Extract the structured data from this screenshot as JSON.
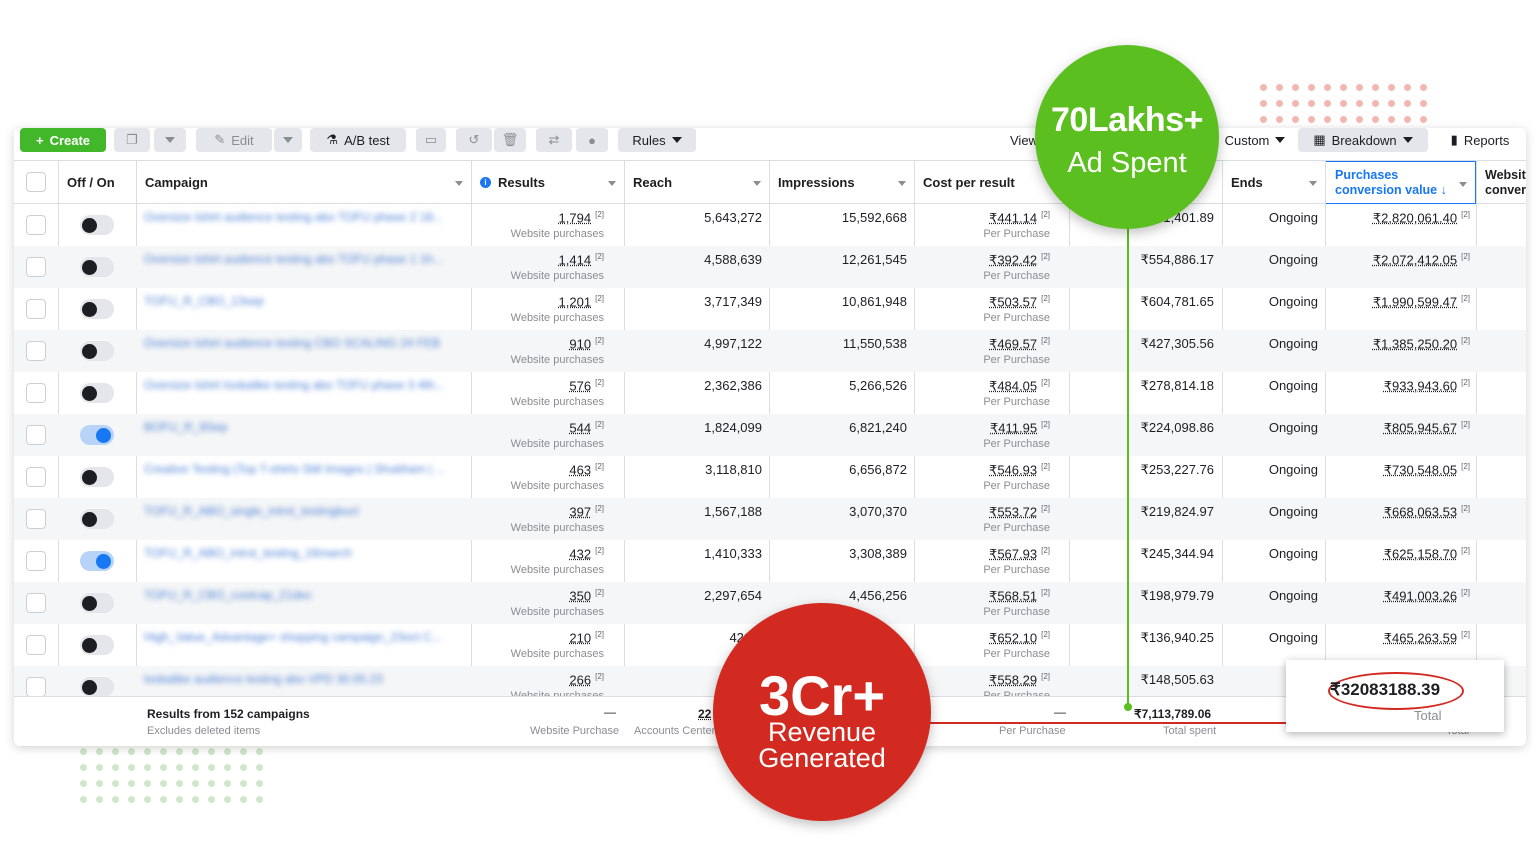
{
  "toolbar": {
    "create": "Create",
    "edit": "Edit",
    "ab_test": "A/B test",
    "rules": "Rules",
    "view": "View",
    "custom": "Custom",
    "breakdown": "Breakdown",
    "reports": "Reports"
  },
  "columns": {
    "off_on": "Off / On",
    "campaign": "Campaign",
    "results": "Results",
    "reach": "Reach",
    "impressions": "Impressions",
    "cost_per_result": "Cost per result",
    "ends": "Ends",
    "purchases_line1": "Purchases",
    "purchases_line2": "conversion value ↓",
    "website_line1": "Websit",
    "website_line2": "conver"
  },
  "rows": [
    {
      "on": false,
      "campaign": "Oversize tshirt audience testing abo TOFU phase 2 18...",
      "results": "1,794",
      "results_sub": "Website purchases",
      "reach": "5,643,272",
      "impressions": "15,592,668",
      "cpr": "₹441.14",
      "cpr_sub": "Per Purchase",
      "spent": "₹1,401.89",
      "ends": "Ongoing",
      "pcv": "₹2,820,061.40"
    },
    {
      "on": false,
      "campaign": "Oversize tshirt audience testing abo TOFU phase 1 1h...",
      "results": "1,414",
      "results_sub": "Website purchases",
      "reach": "4,588,639",
      "impressions": "12,261,545",
      "cpr": "₹392.42",
      "cpr_sub": "Per Purchase",
      "spent": "₹554,886.17",
      "ends": "Ongoing",
      "pcv": "₹2,072,412.05"
    },
    {
      "on": false,
      "campaign": "TOFU_R_CBO_13sep",
      "results": "1,201",
      "results_sub": "Website purchases",
      "reach": "3,717,349",
      "impressions": "10,861,948",
      "cpr": "₹503.57",
      "cpr_sub": "Per Purchase",
      "spent": "₹604,781.65",
      "ends": "Ongoing",
      "pcv": "₹1,990,599.47"
    },
    {
      "on": false,
      "campaign": "Oversize tshirt audience testing CBO SCALING 24 FEB",
      "results": "910",
      "results_sub": "Website purchases",
      "reach": "4,997,122",
      "impressions": "11,550,538",
      "cpr": "₹469.57",
      "cpr_sub": "Per Purchase",
      "spent": "₹427,305.56",
      "ends": "Ongoing",
      "pcv": "₹1,385,250.20"
    },
    {
      "on": false,
      "campaign": "Oversize tshirt lookalike testing abo TOFU phase 3 4th...",
      "results": "576",
      "results_sub": "Website purchases",
      "reach": "2,362,386",
      "impressions": "5,266,526",
      "cpr": "₹484.05",
      "cpr_sub": "Per Purchase",
      "spent": "₹278,814.18",
      "ends": "Ongoing",
      "pcv": "₹933,943.60"
    },
    {
      "on": true,
      "campaign": "BOFU_R_8Sep",
      "results": "544",
      "results_sub": "Website purchases",
      "reach": "1,824,099",
      "impressions": "6,821,240",
      "cpr": "₹411.95",
      "cpr_sub": "Per Purchase",
      "spent": "₹224,098.86",
      "ends": "Ongoing",
      "pcv": "₹805,945.67"
    },
    {
      "on": false,
      "campaign": "Creative Testing (Top T-shirts Still Images | Shubham | ...",
      "results": "463",
      "results_sub": "Website purchases",
      "reach": "3,118,810",
      "impressions": "6,656,872",
      "cpr": "₹546.93",
      "cpr_sub": "Per Purchase",
      "spent": "₹253,227.76",
      "ends": "Ongoing",
      "pcv": "₹730,548.05"
    },
    {
      "on": false,
      "campaign": "TOFU_R_ABO_single_intrst_testingbucl",
      "results": "397",
      "results_sub": "Website purchases",
      "reach": "1,567,188",
      "impressions": "3,070,370",
      "cpr": "₹553.72",
      "cpr_sub": "Per Purchase",
      "spent": "₹219,824.97",
      "ends": "Ongoing",
      "pcv": "₹668,063.53"
    },
    {
      "on": true,
      "campaign": "TOFU_R_ABO_intrst_testing_16march",
      "results": "432",
      "results_sub": "Website purchases",
      "reach": "1,410,333",
      "impressions": "3,308,389",
      "cpr": "₹567.93",
      "cpr_sub": "Per Purchase",
      "spent": "₹245,344.94",
      "ends": "Ongoing",
      "pcv": "₹625,158.70"
    },
    {
      "on": false,
      "campaign": "TOFU_R_CBO_costcap_21dec",
      "results": "350",
      "results_sub": "Website purchases",
      "reach": "2,297,654",
      "impressions": "4,456,256",
      "cpr": "₹568.51",
      "cpr_sub": "Per Purchase",
      "spent": "₹198,979.79",
      "ends": "Ongoing",
      "pcv": "₹491,003.26"
    },
    {
      "on": false,
      "campaign": "High_Value_Advantage+ shopping campaign_23oct C...",
      "results": "210",
      "results_sub": "Website purchases",
      "reach": "421,7",
      "impressions": "",
      "cpr": "₹652.10",
      "cpr_sub": "Per Purchase",
      "spent": "₹136,940.25",
      "ends": "Ongoing",
      "pcv": "₹465,263.59"
    },
    {
      "on": false,
      "campaign": "lookalike audience testing abo VPD 30.05.23",
      "results": "266",
      "results_sub": "Website purchases",
      "reach": "1,1",
      "impressions": "",
      "cpr": "₹558.29",
      "cpr_sub": "Per Purchase",
      "spent": "₹148,505.63",
      "ends": "On",
      "pcv": ""
    }
  ],
  "footer": {
    "title": "Results from 152 campaigns",
    "subtitle": "Excludes deleted items",
    "results_dash": "—",
    "results_sub": "Website Purchase",
    "reach_val": "22",
    "reach_sub": "Accounts Center",
    "cpr_dash": "—",
    "cpr_sub": "Per Purchase",
    "spent": "₹7,113,789.06",
    "spent_sub": "Total spent",
    "total_sub": "Total"
  },
  "overlay": {
    "green_big": "70Lakhs+",
    "green_small": "Ad Spent",
    "red_big": "3Cr+",
    "red_line1": "Revenue",
    "red_line2": "Generated",
    "zoom_value": "₹32083188.39",
    "zoom_label": "Total"
  },
  "colors": {
    "accent": "#1877f2",
    "create": "#42b72a",
    "green_badge": "#5bbf1f",
    "red_badge": "#d22a20"
  }
}
